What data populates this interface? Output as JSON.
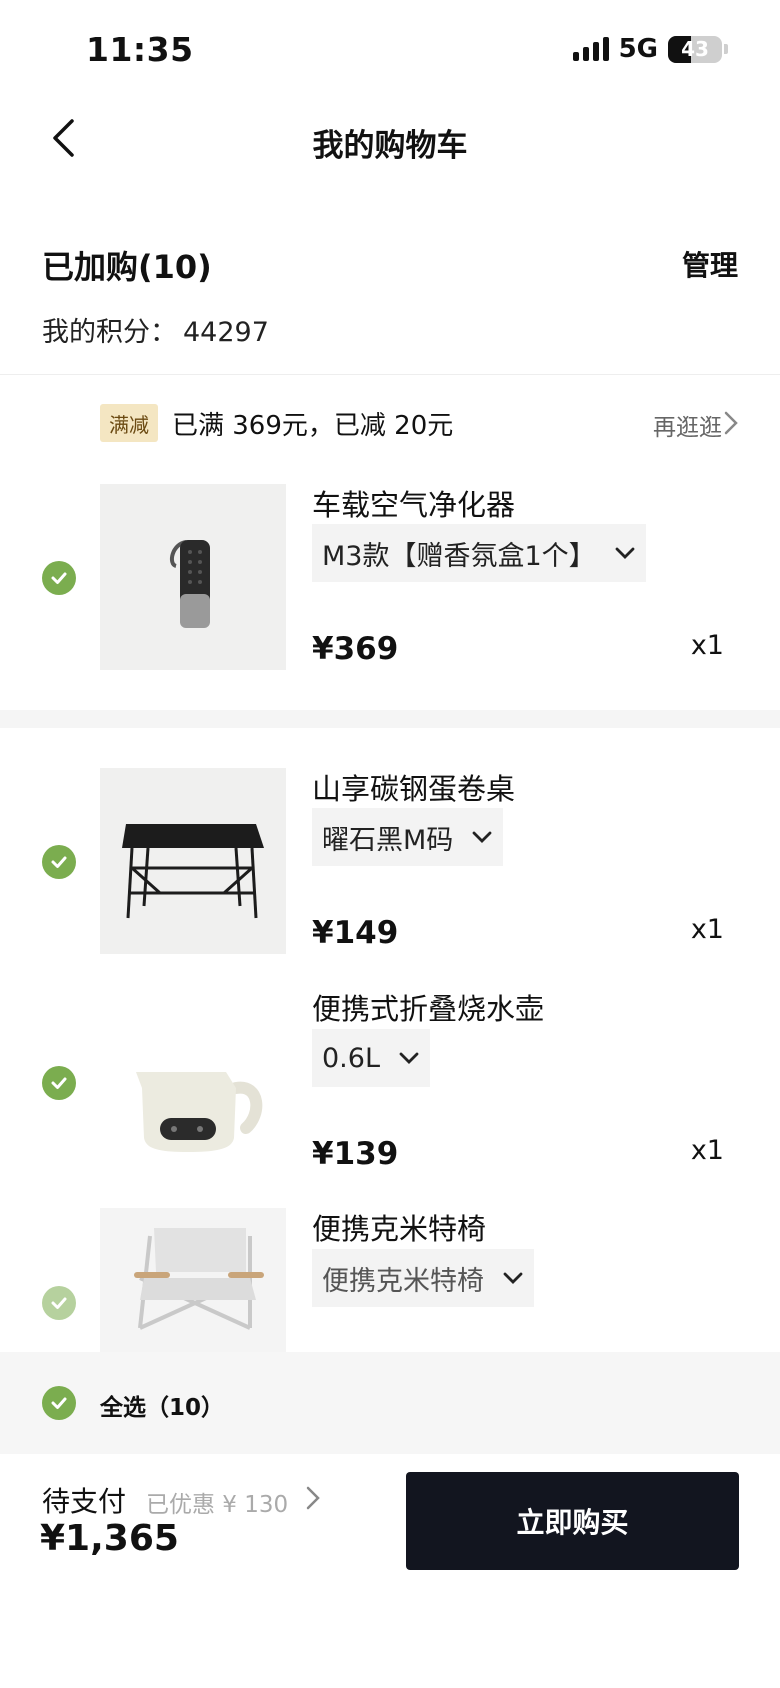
{
  "status": {
    "time": "11:35",
    "network": "5G",
    "battery": "43"
  },
  "nav": {
    "title": "我的购物车"
  },
  "header": {
    "added_label": "已加购(10)",
    "manage_label": "管理",
    "points_label": "我的积分：",
    "points_value": "44297"
  },
  "promo": {
    "tag": "满减",
    "text": "已满 369元，已减 20元",
    "more_label": "再逛逛"
  },
  "items": [
    {
      "name": "车载空气净化器",
      "variant": "M3款【赠香氛盒1个】",
      "price": "¥369",
      "qty": "x1"
    },
    {
      "name": "山享碳钢蛋卷桌",
      "variant": "曜石黑M码",
      "price": "¥149",
      "qty": "x1"
    },
    {
      "name": "便携式折叠烧水壶",
      "variant": "0.6L",
      "price": "¥139",
      "qty": "x1"
    },
    {
      "name": "便携克米特椅",
      "variant": "便携克米特椅"
    }
  ],
  "footer": {
    "select_all_label": "全选（10）",
    "pay_label": "待支付",
    "discount_label": "已优惠 ¥ 130",
    "total": "¥1,365",
    "buy_label": "立即购买"
  },
  "colors": {
    "check": "#7bad4f",
    "buy_button": "#12151f",
    "promo_tag_bg": "#f4e6c2"
  }
}
